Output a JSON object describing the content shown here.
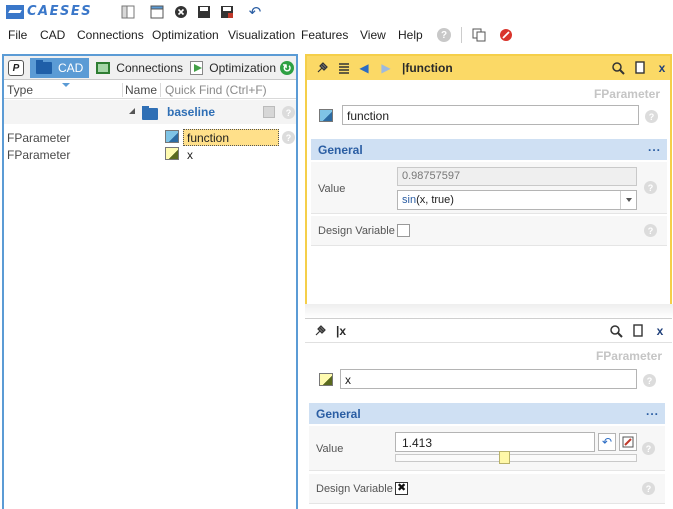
{
  "app": {
    "logo_text": "CAESES",
    "colors": {
      "accent": "#5b9bd5",
      "editor_highlight": "#fbd966",
      "section_bg": "#cfe0f3",
      "section_text": "#2b5ea3"
    }
  },
  "menu": {
    "items": [
      "File",
      "CAD",
      "Connections",
      "Optimization",
      "Visualization",
      "Features",
      "View",
      "Help"
    ],
    "help_icon": "?"
  },
  "left_panel": {
    "tabs": [
      {
        "label": "CAD",
        "icon": "folder-icon",
        "active": true
      },
      {
        "label": "Connections",
        "icon": "monitor-icon",
        "active": false
      },
      {
        "label": "Optimization",
        "icon": "play-icon",
        "active": false
      }
    ],
    "p_icon": "P",
    "refresh_icon": "↻",
    "columns": {
      "type": "Type",
      "name": "Name",
      "quick_find": "Quick Find (Ctrl+F)"
    },
    "tree": {
      "group": {
        "label": "baseline",
        "expanded": true
      },
      "rows": [
        {
          "type": "FParameter",
          "name": "function",
          "selected": true,
          "icon": "parameter-blue-icon"
        },
        {
          "type": "FParameter",
          "name": "x",
          "selected": false,
          "icon": "parameter-yellow-icon"
        }
      ]
    }
  },
  "editor_function": {
    "title": "|function",
    "type_label": "FParameter",
    "name": "function",
    "section": "General",
    "more": "...",
    "value_label": "Value",
    "value_result": "0.98757597",
    "expression_fn": "sin",
    "expression_rest": "(x, true)",
    "design_variable_label": "Design Variable",
    "design_variable": false
  },
  "editor_x": {
    "title": "|x",
    "type_label": "FParameter",
    "name": "x",
    "section": "General",
    "more": "...",
    "value_label": "Value",
    "value": "1.413",
    "slider_fraction": 0.45,
    "design_variable_label": "Design Variable",
    "design_variable": true
  },
  "glyphs": {
    "q": "?",
    "close": "x",
    "back": "◀",
    "forward": "▶",
    "search": "🔍",
    "undo": "↶"
  }
}
